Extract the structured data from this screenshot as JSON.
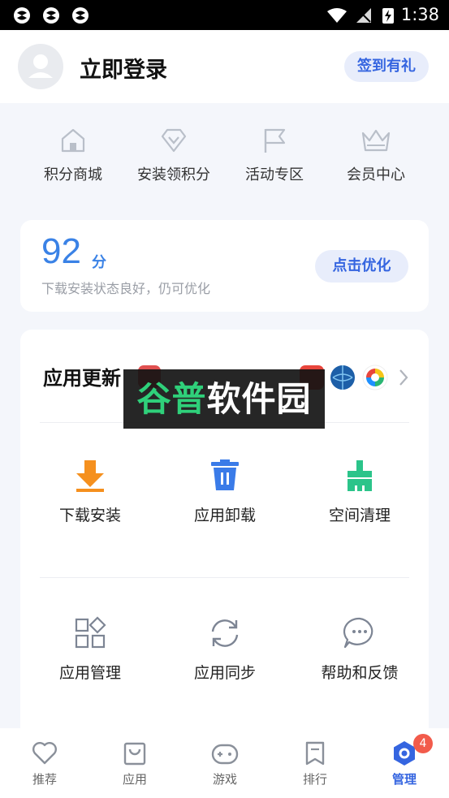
{
  "status_bar": {
    "time": "1:38"
  },
  "header": {
    "login_text": "立即登录",
    "signin_button": "签到有礼"
  },
  "quick_actions": [
    {
      "label": "积分商城",
      "icon": "house-icon"
    },
    {
      "label": "安装领积分",
      "icon": "diamond-icon"
    },
    {
      "label": "活动专区",
      "icon": "flag-icon"
    },
    {
      "label": "会员中心",
      "icon": "crown-icon"
    }
  ],
  "score_card": {
    "score": "92",
    "unit": "分",
    "description": "下载安装状态良好，仍可优化",
    "button": "点击优化"
  },
  "main_card": {
    "update_title": "应用更新",
    "grid": [
      {
        "label": "下载安装",
        "icon": "download-icon"
      },
      {
        "label": "应用卸载",
        "icon": "trash-icon"
      },
      {
        "label": "空间清理",
        "icon": "broom-icon"
      },
      {
        "label": "应用管理",
        "icon": "app-grid-icon"
      },
      {
        "label": "应用同步",
        "icon": "sync-icon"
      },
      {
        "label": "帮助和反馈",
        "icon": "chat-icon"
      }
    ]
  },
  "watermark": {
    "part1": "谷普",
    "part2": "软件园"
  },
  "bottom_nav": {
    "items": [
      {
        "label": "推荐",
        "icon": "heart-icon"
      },
      {
        "label": "应用",
        "icon": "bag-icon"
      },
      {
        "label": "游戏",
        "icon": "gamepad-icon"
      },
      {
        "label": "排行",
        "icon": "bookmark-icon"
      },
      {
        "label": "管理",
        "icon": "hexagon-icon"
      }
    ],
    "active_index": 4,
    "badge": "4"
  },
  "colors": {
    "accent": "#3565e0",
    "score": "#3a82e6",
    "orange": "#f5901e",
    "teal": "#2bc48a",
    "badge": "#f25b4b"
  }
}
